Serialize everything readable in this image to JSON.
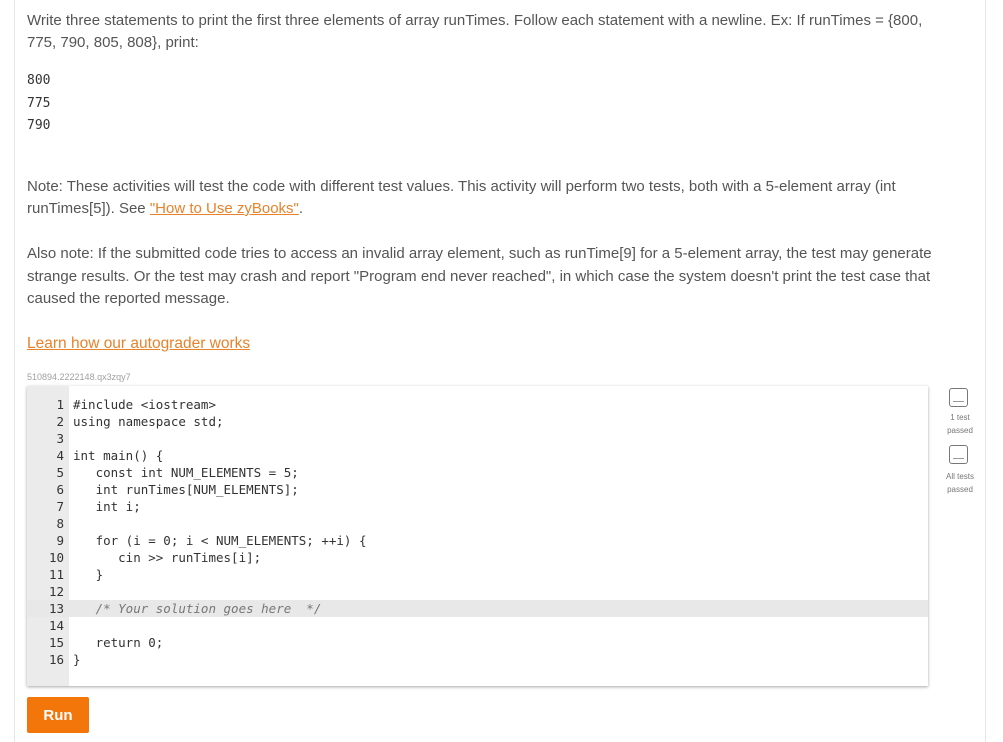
{
  "prompt": {
    "text": "Write three statements to print the first three elements of array runTimes. Follow each statement with a newline. Ex: If runTimes = {800, 775, 790, 805, 808}, print:"
  },
  "example_output": [
    "800",
    "775",
    "790"
  ],
  "note1": {
    "text": "Note: These activities will test the code with different test values. This activity will perform two tests, both with a 5-element array (int runTimes[5]). See ",
    "link": "\"How to Use zyBooks\"",
    "suffix": "."
  },
  "note2": {
    "text": "Also note: If the submitted code tries to access an invalid array element, such as runTime[9] for a 5-element array, the test may generate strange results. Or the test may crash and report \"Program end never reached\", in which case the system doesn't print the test case that caused the reported message."
  },
  "autograder_link": "Learn how our autograder works",
  "activity_id": "510894.2222148.qx3zqy7",
  "editor": {
    "lines": [
      {
        "num": "1",
        "code": "#include <iostream>"
      },
      {
        "num": "2",
        "code": "using namespace std;"
      },
      {
        "num": "3",
        "code": ""
      },
      {
        "num": "4",
        "code": "int main() {"
      },
      {
        "num": "5",
        "code": "   const int NUM_ELEMENTS = 5;"
      },
      {
        "num": "6",
        "code": "   int runTimes[NUM_ELEMENTS];"
      },
      {
        "num": "7",
        "code": "   int i;"
      },
      {
        "num": "8",
        "code": ""
      },
      {
        "num": "9",
        "code": "   for (i = 0; i < NUM_ELEMENTS; ++i) {"
      },
      {
        "num": "10",
        "code": "      cin >> runTimes[i];"
      },
      {
        "num": "11",
        "code": "   }"
      },
      {
        "num": "12",
        "code": ""
      },
      {
        "num": "13",
        "code": "   /* Your solution goes here  */"
      },
      {
        "num": "14",
        "code": ""
      },
      {
        "num": "15",
        "code": "   return 0;"
      },
      {
        "num": "16",
        "code": "}"
      }
    ]
  },
  "run_button": "Run",
  "tests": [
    {
      "label_1": "1 test",
      "label_2": "passed"
    },
    {
      "label_1": "All tests",
      "label_2": "passed"
    }
  ]
}
